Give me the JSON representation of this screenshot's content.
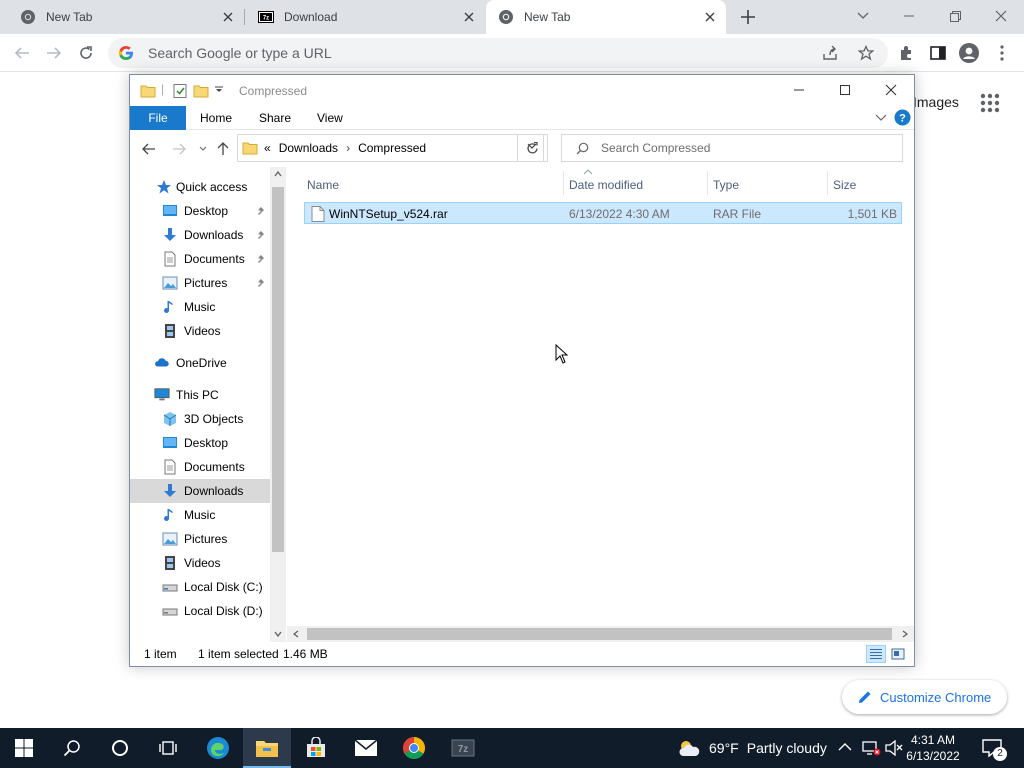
{
  "browser": {
    "tabs": [
      {
        "title": "New Tab",
        "icon": "chrome-icon",
        "active": false
      },
      {
        "title": "Download",
        "icon": "7zip-icon",
        "active": false
      },
      {
        "title": "New Tab",
        "icon": "chrome-icon",
        "active": true
      }
    ],
    "omnibox_placeholder": "Search Google or type a URL",
    "page": {
      "images_link": "Images",
      "customize_label": "Customize Chrome"
    }
  },
  "explorer": {
    "title": "Compressed",
    "ribbon_tabs": [
      "File",
      "Home",
      "Share",
      "View"
    ],
    "breadcrumb": {
      "prefix": "«",
      "items": [
        "Downloads",
        "Compressed"
      ],
      "separator": "›"
    },
    "search_placeholder": "Search Compressed",
    "nav": {
      "quick_access": "Quick access",
      "quick_items": [
        "Desktop",
        "Downloads",
        "Documents",
        "Pictures",
        "Music",
        "Videos"
      ],
      "onedrive": "OneDrive",
      "this_pc": "This PC",
      "pc_items": [
        "3D Objects",
        "Desktop",
        "Documents",
        "Downloads",
        "Music",
        "Pictures",
        "Videos",
        "Local Disk (C:)",
        "Local Disk (D:)"
      ],
      "selected": "Downloads"
    },
    "columns": {
      "name": "Name",
      "date": "Date modified",
      "type": "Type",
      "size": "Size"
    },
    "files": [
      {
        "name": "WinNTSetup_v524.rar",
        "date": "6/13/2022 4:30 AM",
        "type": "RAR File",
        "size": "1,501 KB",
        "selected": true
      }
    ],
    "status": {
      "count": "1 item",
      "selected": "1 item selected",
      "size": "1.46 MB"
    }
  },
  "taskbar": {
    "weather": {
      "temp": "69°F",
      "condition": "Partly cloudy"
    },
    "clock": {
      "time": "4:31 AM",
      "date": "6/13/2022"
    },
    "notifications": "2"
  },
  "colors": {
    "accent": "#1979ca",
    "selection": "#cce8ff",
    "taskbar": "#101c2a",
    "chrome_blue": "#1a73e8"
  }
}
